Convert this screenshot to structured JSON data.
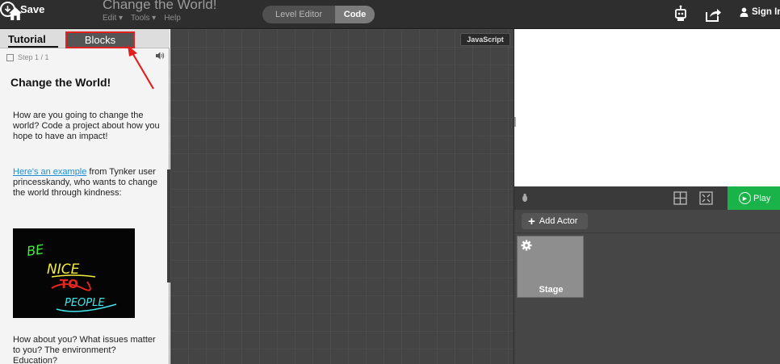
{
  "topbar": {
    "save_label": "Save",
    "project_title": "Change the World!",
    "menus": [
      "Edit ▾",
      "Tools ▾",
      "Help"
    ],
    "mode_tabs": [
      "Level Editor",
      "Code"
    ],
    "active_mode": "Code",
    "signin_label": "Sign In"
  },
  "left_panel": {
    "tabs": [
      "Tutorial",
      "Blocks"
    ],
    "active_tab": "Tutorial",
    "step_label": "Step 1 / 1",
    "tutorial": {
      "title": "Change the World!",
      "paragraph1": "How are you going to change the world? Code a project about how you hope to have an impact!",
      "link_text": "Here's an example",
      "paragraph2_rest": " from Tynker user princesskandy, who wants to change the world through kindness:",
      "image_words": [
        "BE",
        "NICE",
        "TO",
        "PEOPLE"
      ],
      "paragraph3": "How about you? What issues matter to you? The environment? Education?"
    }
  },
  "workspace": {
    "language_button": "JavaScript"
  },
  "stage": {
    "play_label": "Play",
    "add_actor_label": "Add Actor",
    "actor_card_label": "Stage"
  },
  "icons": [
    "home-icon",
    "save-icon",
    "robot-icon",
    "share-icon",
    "user-icon",
    "speaker-icon",
    "chevron-left-icon",
    "bug-icon",
    "grid-icon",
    "fullscreen-icon",
    "play-icon",
    "plus-icon",
    "gear-icon"
  ],
  "colors": {
    "topbar": "#2e2e2e",
    "workspace": "#444444",
    "play": "#19b34a",
    "link": "#1a8fd8",
    "highlight": "#e0211f"
  }
}
